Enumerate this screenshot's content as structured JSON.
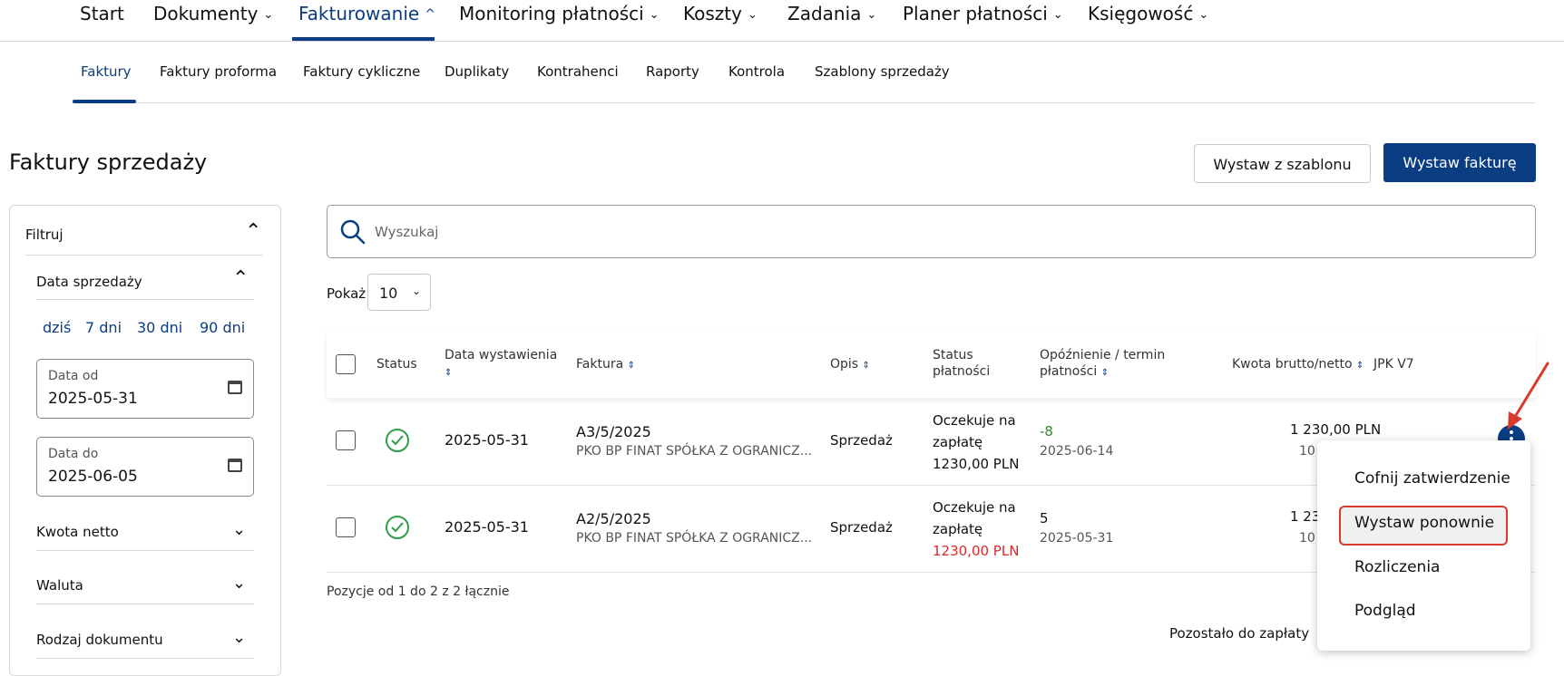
{
  "top_nav": {
    "items": [
      {
        "label": "Start",
        "chevron": ""
      },
      {
        "label": "Dokumenty",
        "chevron": "⌄"
      },
      {
        "label": "Fakturowanie",
        "chevron": "^"
      },
      {
        "label": "Monitoring płatności",
        "chevron": "⌄"
      },
      {
        "label": "Koszty",
        "chevron": "⌄"
      },
      {
        "label": "Zadania",
        "chevron": "⌄"
      },
      {
        "label": "Planer płatności",
        "chevron": "⌄"
      },
      {
        "label": "Księgowość",
        "chevron": "⌄"
      }
    ],
    "active": "Fakturowanie"
  },
  "sub_nav": {
    "items": [
      "Faktury",
      "Faktury proforma",
      "Faktury cykliczne",
      "Duplikaty",
      "Kontrahenci",
      "Raporty",
      "Kontrola",
      "Szablony sprzedaży"
    ],
    "active": "Faktury"
  },
  "page": {
    "title": "Faktury sprzedaży",
    "btn_template": "Wystaw z szablonu",
    "btn_issue": "Wystaw fakturę"
  },
  "filter": {
    "title": "Filtruj",
    "sale_date": "Data sprzedaży",
    "quick": [
      "dziś",
      "7 dni",
      "30 dni",
      "90 dni"
    ],
    "date_from_label": "Data od",
    "date_from_value": "2025-05-31",
    "date_to_label": "Data do",
    "date_to_value": "2025-06-05",
    "net_amount": "Kwota netto",
    "currency": "Waluta",
    "doc_type": "Rodzaj dokumentu"
  },
  "search": {
    "placeholder": "Wyszukaj"
  },
  "show": {
    "label": "Pokaż",
    "value": "10"
  },
  "table": {
    "headers": {
      "status": "Status",
      "issue_date": "Data wystawienia",
      "invoice": "Faktura",
      "desc": "Opis",
      "pay_status_1": "Status",
      "pay_status_2": "płatności",
      "delay_1": "Opóźnienie / termin",
      "delay_2": "płatności",
      "amount": "Kwota brutto/netto",
      "jpk": "JPK V7"
    },
    "rows": [
      {
        "date": "2025-05-31",
        "number": "A3/5/2025",
        "client": "PKO BP FINAT SPÓŁKA Z OGRANICZ...",
        "desc": "Sprzedaż",
        "pay_1": "Oczekuje na",
        "pay_2": "zapłatę",
        "pay_amount": "1230,00 PLN",
        "delay": "-8",
        "due": "2025-06-14",
        "gross": "1 230,00 PLN",
        "net": "10"
      },
      {
        "date": "2025-05-31",
        "number": "A2/5/2025",
        "client": "PKO BP FINAT SPÓŁKA Z OGRANICZ...",
        "desc": "Sprzedaż",
        "pay_1": "Oczekuje na",
        "pay_2": "zapłatę",
        "pay_amount": "1230,00 PLN",
        "delay": "5",
        "due": "2025-05-31",
        "gross": "1 23",
        "net": "10"
      }
    ],
    "pagination": "Pozycje od 1 do 2 z 2 łącznie",
    "remaining_label": "Pozostało do zapłaty"
  },
  "menu": {
    "items": [
      "Cofnij zatwierdzenie",
      "Wystaw ponownie",
      "Rozliczenia",
      "Podgląd"
    ],
    "highlighted": "Wystaw ponownie"
  },
  "colors": {
    "brand": "#0a3d82",
    "success": "#2e9e48",
    "danger": "#d92b2b",
    "annotation": "#d93a2b"
  }
}
